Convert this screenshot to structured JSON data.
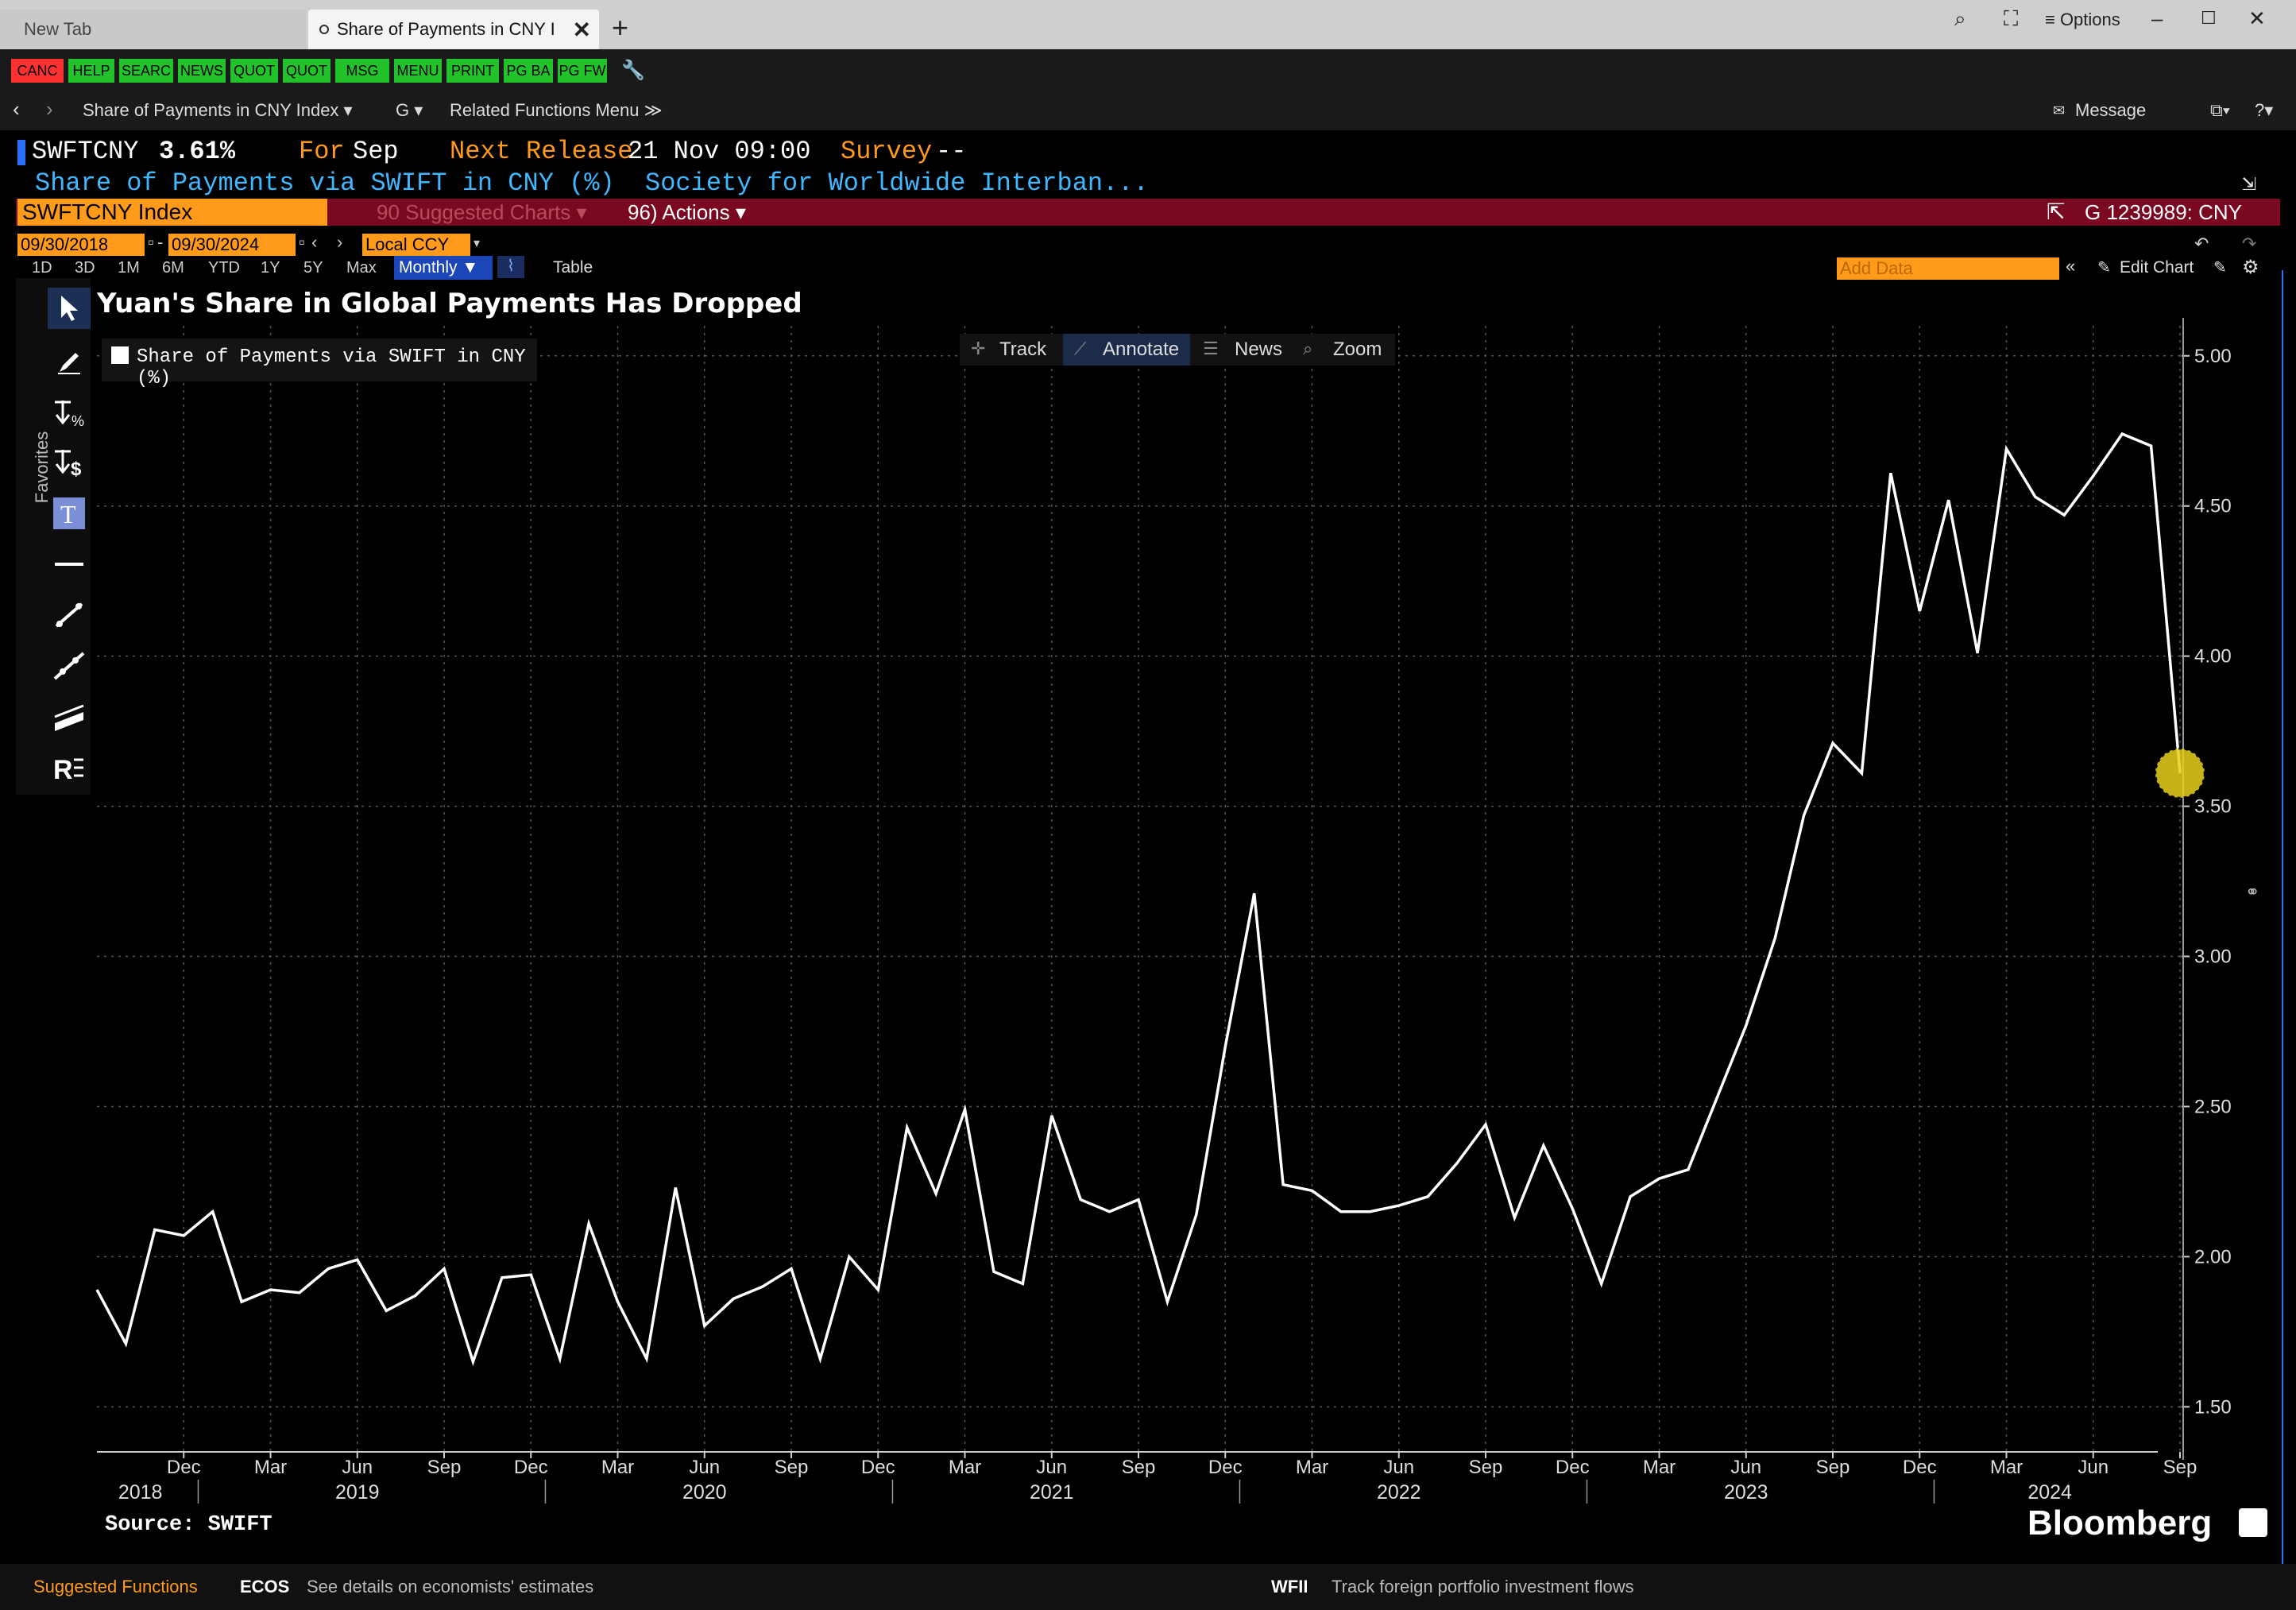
{
  "browser": {
    "tab_new": "New Tab",
    "tab_active": "Share of Payments in CNY I",
    "options_label": "≡ Options"
  },
  "fn_buttons": [
    {
      "label": "CANC",
      "color": "#ff3030"
    },
    {
      "label": "HELP",
      "color": "#22c22a"
    },
    {
      "label": "SEARC",
      "color": "#22c22a"
    },
    {
      "label": "NEWS",
      "color": "#22c22a"
    },
    {
      "label": "QUOT",
      "color": "#22c22a"
    },
    {
      "label": "QUOT",
      "color": "#22c22a"
    },
    {
      "label": "MSG",
      "color": "#22c22a"
    },
    {
      "label": "MENU",
      "color": "#22c22a"
    },
    {
      "label": "PRINT",
      "color": "#22c22a"
    },
    {
      "label": "PG BA",
      "color": "#22c22a"
    },
    {
      "label": "PG FW",
      "color": "#22c22a"
    }
  ],
  "nav": {
    "crumb": "Share of Payments in CNY Index ▾",
    "g_menu": "G ▾",
    "related": "Related Functions Menu ≫",
    "message": "Message"
  },
  "header": {
    "ticker": "SWFTCNY",
    "value": "3.61%",
    "for_label": "For",
    "for_value": "Sep",
    "next_label": "Next Release",
    "next_value": "21 Nov 09:00",
    "survey_label": "Survey",
    "survey_value": "--",
    "description": "Share of Payments via SWIFT in CNY (%)",
    "source_org": "Society for Worldwide Interban...",
    "security": "SWFTCNY Index",
    "suggested": "90 Suggested Charts ▾",
    "actions": "96) Actions ▾",
    "chart_id": "G 1239989: CNY"
  },
  "controls": {
    "start_date": "09/30/2018",
    "end_date": "09/30/2024",
    "currency": "Local CCY",
    "ranges": [
      "1D",
      "3D",
      "1M",
      "6M",
      "YTD",
      "1Y",
      "5Y",
      "Max"
    ],
    "frequency": "Monthly ▼",
    "table": "Table",
    "add_data": "Add Data",
    "edit_chart": "Edit Chart"
  },
  "chart_tools": {
    "track": "Track",
    "annotate": "Annotate",
    "news": "News",
    "zoom": "Zoom"
  },
  "sidebar": {
    "favorites": "Favorites"
  },
  "chart_data": {
    "type": "line",
    "title": "Yuan's Share in Global Payments Has Dropped",
    "series": [
      {
        "name": "Share of Payments via SWIFT in CNY (%)",
        "color": "#ffffff",
        "x": [
          "2018-09",
          "2018-10",
          "2018-11",
          "2018-12",
          "2019-01",
          "2019-02",
          "2019-03",
          "2019-04",
          "2019-05",
          "2019-06",
          "2019-07",
          "2019-08",
          "2019-09",
          "2019-10",
          "2019-11",
          "2019-12",
          "2020-01",
          "2020-02",
          "2020-03",
          "2020-04",
          "2020-05",
          "2020-06",
          "2020-07",
          "2020-08",
          "2020-09",
          "2020-10",
          "2020-11",
          "2020-12",
          "2021-01",
          "2021-02",
          "2021-03",
          "2021-04",
          "2021-05",
          "2021-06",
          "2021-07",
          "2021-08",
          "2021-09",
          "2021-10",
          "2021-11",
          "2021-12",
          "2022-01",
          "2022-02",
          "2022-03",
          "2022-04",
          "2022-05",
          "2022-06",
          "2022-07",
          "2022-08",
          "2022-09",
          "2022-10",
          "2022-11",
          "2022-12",
          "2023-01",
          "2023-02",
          "2023-03",
          "2023-04",
          "2023-05",
          "2023-06",
          "2023-07",
          "2023-08",
          "2023-09",
          "2023-10",
          "2023-11",
          "2023-12",
          "2024-01",
          "2024-02",
          "2024-03",
          "2024-04",
          "2024-05",
          "2024-06",
          "2024-07",
          "2024-08",
          "2024-09"
        ],
        "values": [
          1.89,
          1.71,
          2.09,
          2.07,
          2.15,
          1.85,
          1.89,
          1.88,
          1.96,
          1.99,
          1.82,
          1.87,
          1.96,
          1.65,
          1.93,
          1.94,
          1.66,
          2.11,
          1.85,
          1.66,
          2.23,
          1.77,
          1.86,
          1.9,
          1.96,
          1.66,
          2.0,
          1.89,
          2.43,
          2.21,
          2.49,
          1.95,
          1.91,
          2.47,
          2.19,
          2.15,
          2.19,
          1.85,
          2.14,
          2.7,
          3.21,
          2.24,
          2.22,
          2.15,
          2.15,
          2.17,
          2.2,
          2.31,
          2.44,
          2.13,
          2.37,
          2.16,
          1.91,
          2.2,
          2.26,
          2.29,
          2.53,
          2.77,
          3.06,
          3.47,
          3.71,
          3.61,
          4.61,
          4.15,
          4.52,
          4.01,
          4.69,
          4.53,
          4.47,
          4.6,
          4.74,
          4.7,
          3.61
        ]
      }
    ],
    "ylim": [
      1.35,
      5.1
    ],
    "yticks": [
      "5.00",
      "4.50",
      "4.00",
      "3.50",
      "3.00",
      "2.50",
      "2.00",
      "1.50"
    ],
    "xtick_labels": [
      "Dec",
      "Mar",
      "Jun",
      "Sep",
      "Dec",
      "Mar",
      "Jun",
      "Sep",
      "Dec",
      "Mar",
      "Jun",
      "Sep",
      "Dec",
      "Mar",
      "Jun",
      "Sep",
      "Dec",
      "Mar",
      "Jun",
      "Sep",
      "Dec",
      "Mar",
      "Jun",
      "Sep"
    ],
    "year_labels": [
      "2018",
      "2019",
      "2020",
      "2021",
      "2022",
      "2023",
      "2024"
    ],
    "grid": true,
    "legend_position": "top-left",
    "source_note": "Source: SWIFT",
    "watermark": "Bloomberg",
    "highlight_color": "#e8d01c"
  },
  "footer": {
    "suggested": "Suggested Functions",
    "ecos_code": "ECOS",
    "ecos_desc": "See details on economists' estimates",
    "wfii_code": "WFII",
    "wfii_desc": "Track foreign portfolio investment flows"
  }
}
